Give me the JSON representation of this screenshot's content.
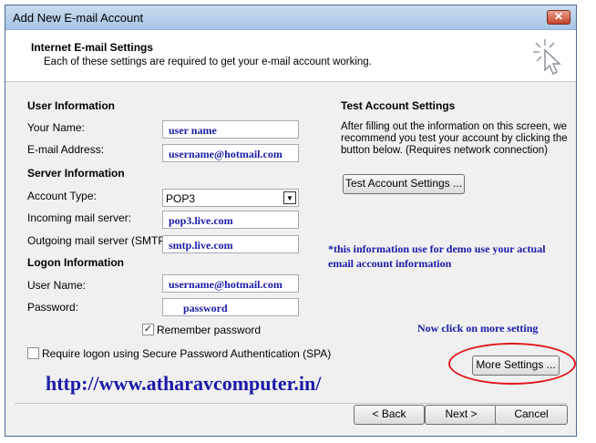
{
  "window": {
    "title": "Add New E-mail Account",
    "close_label": "✕"
  },
  "header": {
    "title": "Internet E-mail Settings",
    "subtitle": "Each of these settings are required to get your e-mail account working."
  },
  "user_info": {
    "heading": "User Information",
    "your_name_label": "Your Name:",
    "your_name_value": "user name",
    "email_label": "E-mail Address:",
    "email_value": "username@hotmail.com"
  },
  "server_info": {
    "heading": "Server Information",
    "account_type_label": "Account Type:",
    "account_type_value": "POP3",
    "incoming_label": "Incoming mail server:",
    "incoming_value": "pop3.live.com",
    "outgoing_label": "Outgoing mail server (SMTP):",
    "outgoing_value": "smtp.live.com"
  },
  "logon_info": {
    "heading": "Logon Information",
    "user_name_label": "User Name:",
    "user_name_value": "username@hotmail.com",
    "password_label": "Password:",
    "password_value": "password",
    "remember_label": "Remember password",
    "remember_checked": true,
    "spa_label": "Require logon using Secure Password Authentication (SPA)",
    "spa_checked": false
  },
  "test_settings": {
    "heading": "Test Account Settings",
    "description_1": "After filling out the information on this screen, we",
    "description_2": "recommend you test your account by clicking the",
    "description_3": "button below. (Requires network connection)",
    "button_label": "Test Account Settings ..."
  },
  "annotations": {
    "demo_note_1": "*this information use for demo use your actual",
    "demo_note_2": "email account information",
    "click_note": "Now click on  more setting",
    "url": "http://www.atharavcomputer.in/"
  },
  "buttons": {
    "more_settings": "More Settings ...",
    "back": "< Back",
    "next": "Next >",
    "cancel": "Cancel"
  },
  "colors": {
    "annotation_blue": "#1a1aa8",
    "highlight_red": "#e0181b",
    "title_blue": "#a9c5e6"
  }
}
